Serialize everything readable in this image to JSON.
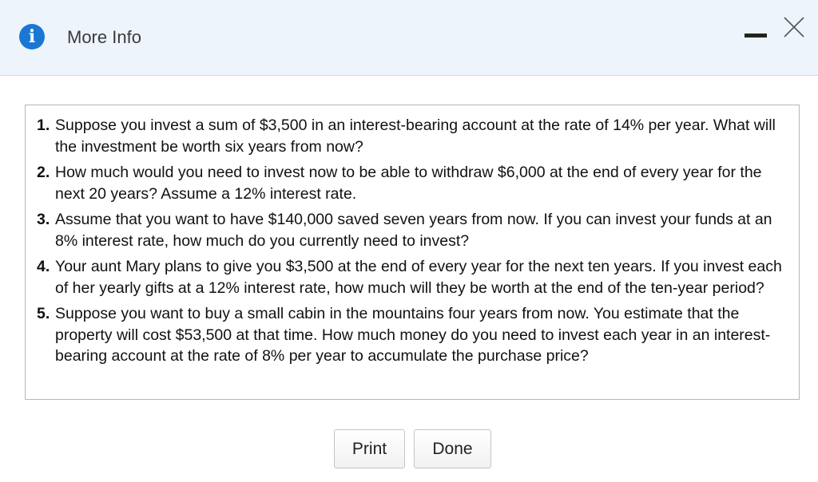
{
  "dialog": {
    "title": "More Info",
    "info_icon_glyph": "i",
    "icons": {
      "info": "info-icon",
      "minimize": "minimize-icon",
      "close": "close-icon"
    },
    "colors": {
      "header_bg": "#eef4fb",
      "accent": "#1a78d4"
    }
  },
  "questions": [
    {
      "number": "1.",
      "text": "Suppose you invest a sum of $3,500 in an interest-bearing account at the rate of 14% per year. What will the investment be worth six years from now?"
    },
    {
      "number": "2.",
      "text": "How much would you need to invest now to be able to withdraw $6,000 at the end of every year for the next 20 years? Assume a 12% interest rate."
    },
    {
      "number": "3.",
      "text": "Assume that you want to have $140,000 saved seven years from now. If you can invest your funds at an 8% interest rate, how much do you currently need to invest?"
    },
    {
      "number": "4.",
      "text": "Your aunt Mary plans to give you $3,500 at the end of every year for the next ten years. If you invest each of her yearly gifts at a 12% interest rate, how much will they be worth at the end of the ten-year period?"
    },
    {
      "number": "5.",
      "text": "Suppose you want to buy a small cabin in the mountains four years from now. You estimate that the property will cost $53,500 at that time. How much money do you need to invest each year in an interest-bearing account at the rate of 8% per year to accumulate the purchase price?"
    }
  ],
  "buttons": {
    "print_label": "Print",
    "done_label": "Done"
  }
}
